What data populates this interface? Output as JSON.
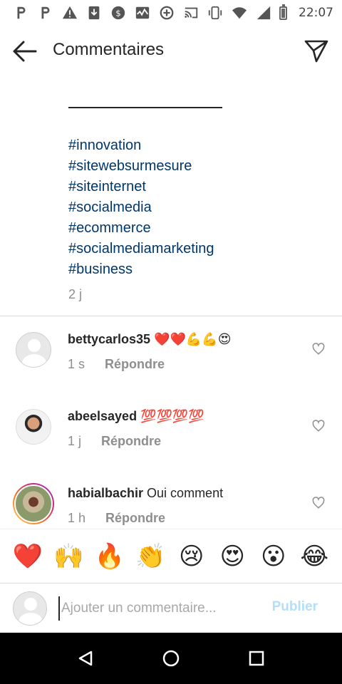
{
  "status_bar": {
    "time": "22:07",
    "icons": [
      "p-app-icon",
      "p-app-icon",
      "warning-icon",
      "download-icon",
      "vpn-icon",
      "activity-icon",
      "data-saver-icon",
      "cast-icon",
      "vibrate-icon",
      "wifi-icon",
      "signal-icon",
      "battery-icon"
    ]
  },
  "header": {
    "title": "Commentaires",
    "back_icon": "arrow-left-icon",
    "send_icon": "paper-plane-icon"
  },
  "caption": {
    "hashtags": [
      "#innovation",
      "#sitewebsurmesure",
      "#siteinternet",
      "#socialmedia",
      "#ecommerce",
      "#socialmediamarketing",
      "#business"
    ],
    "time": "2 j"
  },
  "comments": [
    {
      "username": "bettycarlos35",
      "text": "❤️❤️💪💪😍",
      "time": "1 s",
      "reply_label": "Répondre"
    },
    {
      "username": "abeelsayed",
      "text": "💯💯💯💯",
      "time": "1 j",
      "reply_label": "Répondre"
    },
    {
      "username": "habialbachir",
      "text": "Oui comment",
      "time": "1 h",
      "reply_label": "Répondre"
    }
  ],
  "emoji_bar": [
    "❤️",
    "🙌",
    "🔥",
    "👏",
    "😢",
    "😍",
    "😮",
    "😂"
  ],
  "input": {
    "placeholder": "Ajouter un commentaire...",
    "publish_label": "Publier"
  },
  "colors": {
    "hashtag": "#00376b",
    "secondary_text": "#8e8e8e",
    "publish_disabled": "#b2dffc"
  }
}
